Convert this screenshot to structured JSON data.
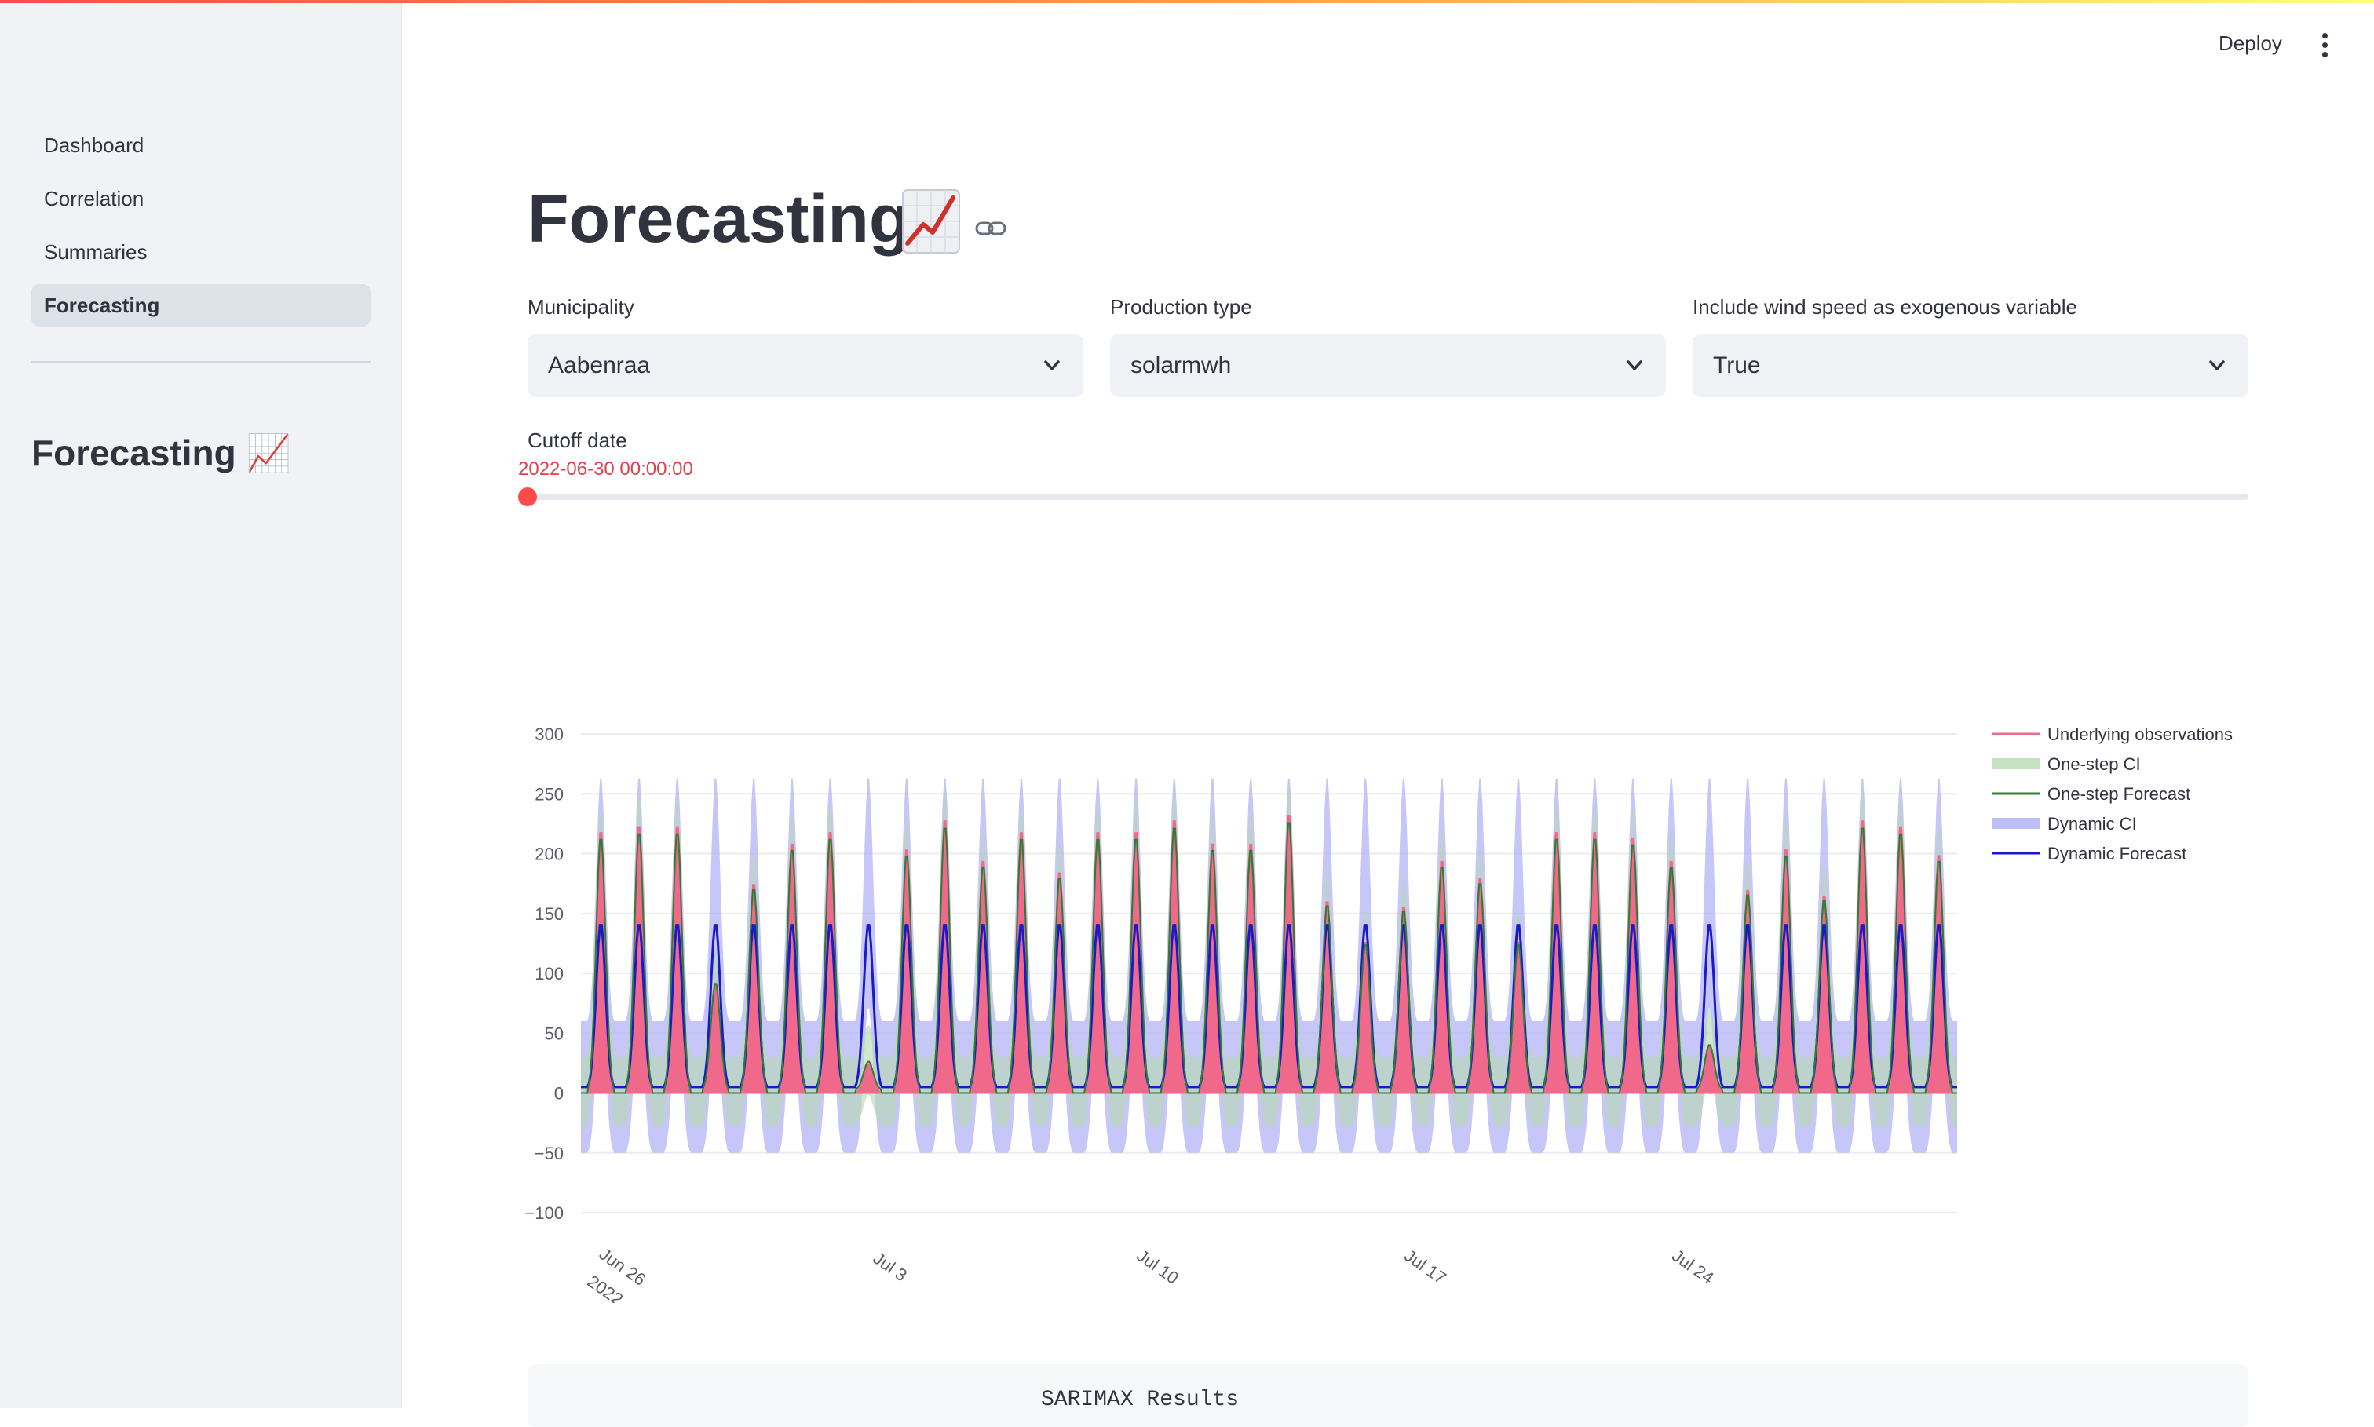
{
  "sidebar": {
    "items": [
      {
        "label": "Dashboard"
      },
      {
        "label": "Correlation"
      },
      {
        "label": "Summaries"
      },
      {
        "label": "Forecasting",
        "active": true
      }
    ],
    "heading": "Forecasting 📈"
  },
  "header": {
    "deploy_label": "Deploy",
    "menu_icon": "kebab-menu-icon"
  },
  "main": {
    "title": "Forecasting",
    "title_icon": "chart-increasing-icon",
    "filters": [
      {
        "label": "Municipality",
        "value": "Aabenraa"
      },
      {
        "label": "Production type",
        "value": "solarmwh"
      },
      {
        "label": "Include wind speed as exogenous variable",
        "value": "True"
      }
    ],
    "cutoff": {
      "label": "Cutoff date",
      "value": "2022-06-30 00:00:00",
      "position": 0.0
    },
    "results_title": "SARIMAX Results"
  },
  "colors": {
    "accent": "#ff4b4b",
    "observations": "#f0688a",
    "onestep_ci": "#b9d9b4",
    "onestep_forecast": "#2e7d32",
    "dynamic_ci": "#b3b3f5",
    "dynamic_forecast": "#1a1ac8"
  },
  "chart_data": {
    "type": "line",
    "title": "",
    "xlabel": "",
    "ylabel": "",
    "ylim": [
      -100,
      300
    ],
    "yticks": [
      "300",
      "250",
      "200",
      "150",
      "100",
      "50",
      "0",
      "−50",
      "−100"
    ],
    "xtick_labels": [
      {
        "date": "2022-06-26",
        "label": "Jun 26",
        "sub": "2022"
      },
      {
        "date": "2022-07-03",
        "label": "Jul 3"
      },
      {
        "date": "2022-07-10",
        "label": "Jul 10"
      },
      {
        "date": "2022-07-17",
        "label": "Jul 17"
      },
      {
        "date": "2022-07-24",
        "label": "Jul 24"
      }
    ],
    "x_start": "2022-06-25",
    "x_end": "2022-07-31",
    "grid": true,
    "legend_position": "top-right",
    "legend": [
      "Underlying observations",
      "One-step CI",
      "One-step Forecast",
      "Dynamic CI",
      "Dynamic Forecast"
    ],
    "daily_peak_observations": [
      225,
      230,
      230,
      95,
      180,
      215,
      225,
      25,
      210,
      235,
      200,
      225,
      190,
      225,
      225,
      235,
      215,
      215,
      240,
      165,
      130,
      160,
      200,
      185,
      130,
      225,
      225,
      220,
      200,
      40,
      175,
      210,
      170,
      235,
      230,
      205,
      210
    ],
    "dynamic_forecast_peak": 140
  }
}
